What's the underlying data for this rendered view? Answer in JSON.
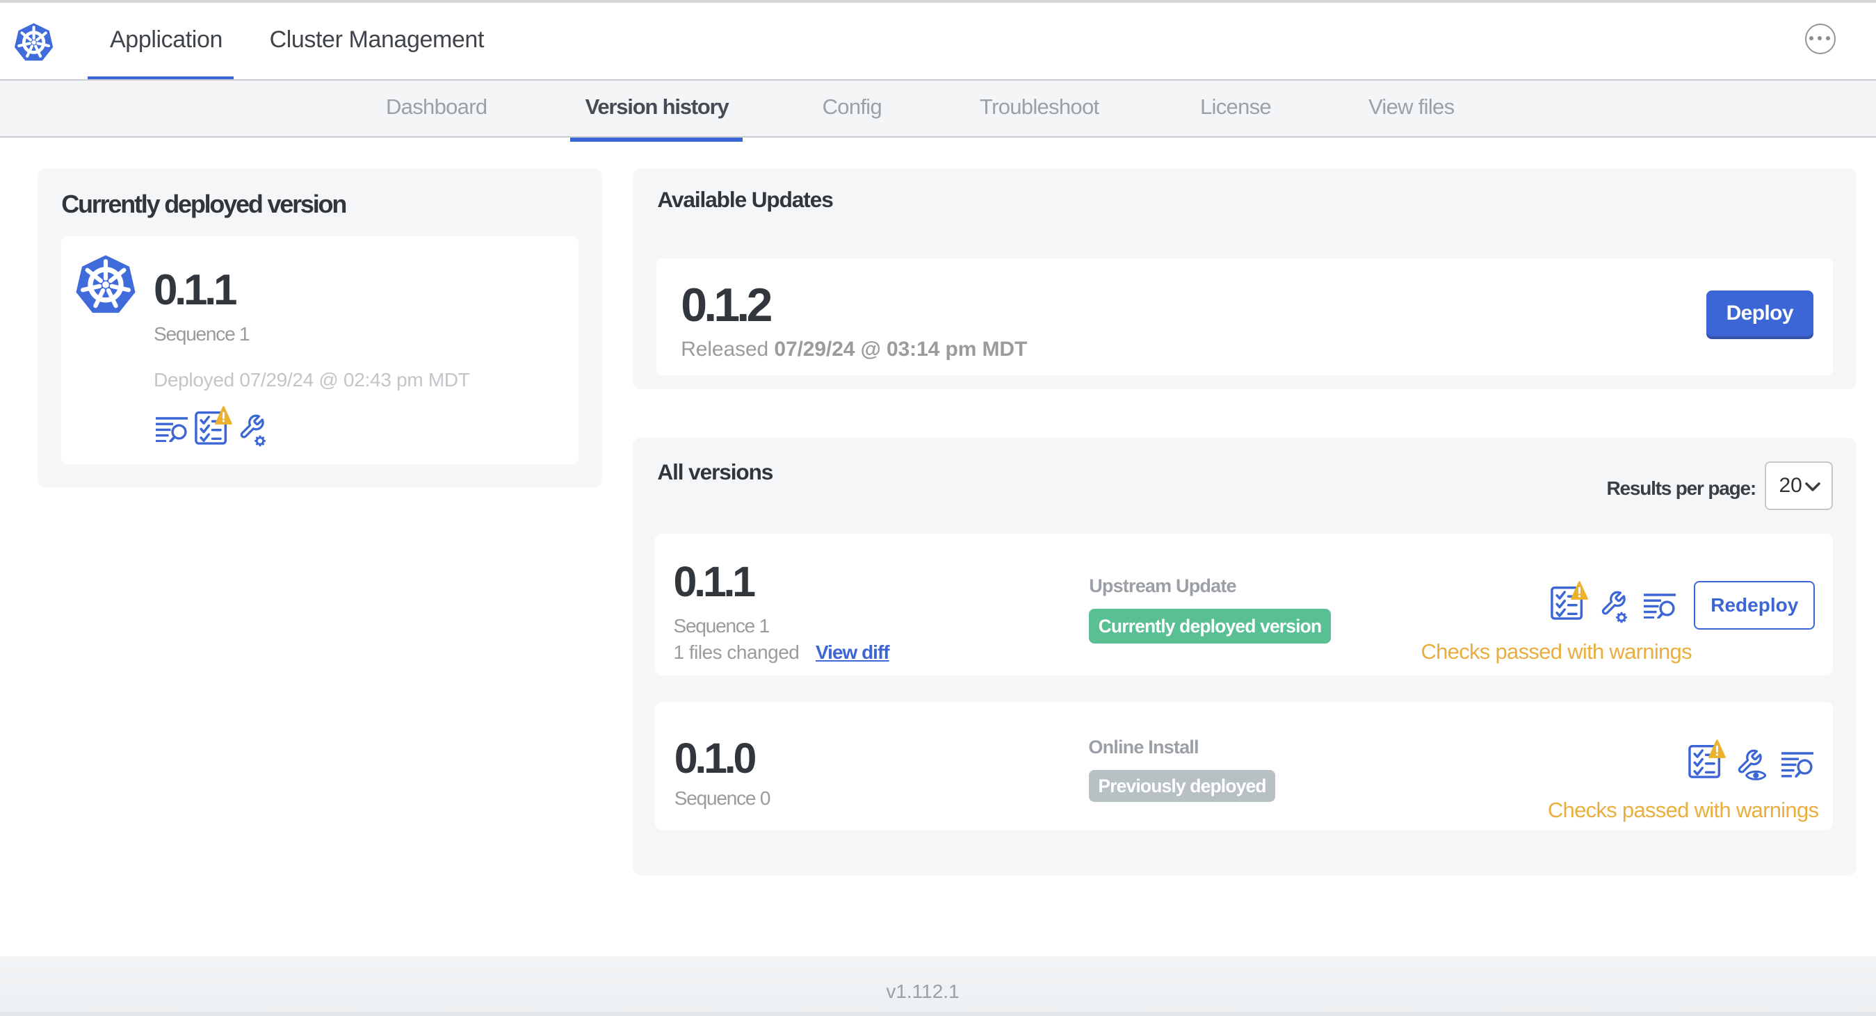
{
  "topbar": {
    "logo": "kubernetes-logo",
    "tabs": [
      {
        "label": "Application",
        "active": true
      },
      {
        "label": "Cluster Management",
        "active": false
      }
    ],
    "menu": "ellipsis-menu"
  },
  "subnav": {
    "tabs": [
      {
        "label": "Dashboard",
        "active": false
      },
      {
        "label": "Version history",
        "active": true
      },
      {
        "label": "Config",
        "active": false
      },
      {
        "label": "Troubleshoot",
        "active": false
      },
      {
        "label": "License",
        "active": false
      },
      {
        "label": "View files",
        "active": false
      }
    ]
  },
  "current_version": {
    "heading": "Currently deployed version",
    "version": "0.1.1",
    "sequence": "Sequence 1",
    "deployed": "Deployed 07/29/24 @ 02:43 pm MDT",
    "icons": [
      "diff-icon",
      "preflight-warning-icon",
      "config-gear-icon"
    ]
  },
  "available_updates": {
    "heading": "Available Updates",
    "version": "0.1.2",
    "released_prefix": "Released",
    "released_value": "07/29/24 @ 03:14 pm MDT",
    "deploy_label": "Deploy"
  },
  "all_versions": {
    "heading": "All versions",
    "results_per_page_label": "Results per page:",
    "results_per_page_value": "20",
    "rows": [
      {
        "version": "0.1.1",
        "sequence": "Sequence 1",
        "files_changed": "1 files changed",
        "view_diff_label": "View diff",
        "source_label": "Upstream Update",
        "status_badge": "Currently deployed version",
        "action_label": "Redeploy",
        "checks_label": "Checks passed with warnings"
      },
      {
        "version": "0.1.0",
        "sequence": "Sequence 0",
        "source_label": "Online Install",
        "status_badge": "Previously deployed",
        "checks_label": "Checks passed with warnings"
      }
    ]
  },
  "footer": {
    "app_version": "v1.112.1"
  },
  "colors": {
    "accent_blue": "#3c66d6",
    "badge_green": "#58c092",
    "badge_gray": "#b7c1c3",
    "warning_amber": "#ecb22d",
    "warning_text": "#e9ae3d"
  }
}
